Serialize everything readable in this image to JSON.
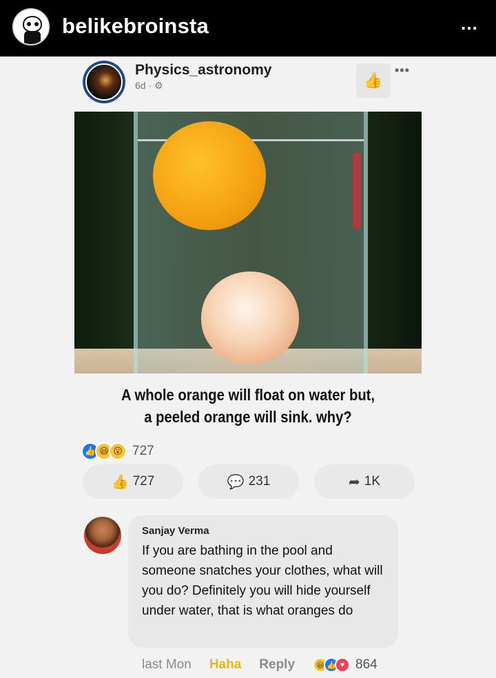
{
  "instagram": {
    "username": "belikebroinsta",
    "more_label": "…"
  },
  "post": {
    "page_name": "Physics_astronomy",
    "meta": "6d · ⚙",
    "like_page_icon": "thumbs-up-icon",
    "more_label": "•••",
    "caption_line1": "A whole orange will float on water but,",
    "caption_line2": "a peeled orange will sink. why?",
    "reaction_count": "727",
    "actions": {
      "like": "727",
      "comment": "231",
      "share": "1K"
    }
  },
  "comment": {
    "author": "Sanjay Verma",
    "text": "If you are bathing in the pool and someone snatches your clothes, what will you do? Definitely you will hide yourself under water, that is what oranges do",
    "time": "last Mon",
    "haha_label": "Haha",
    "reply_label": "Reply",
    "reaction_count": "864"
  },
  "colors": {
    "facebook_blue": "#1877f2",
    "haha_yellow": "#e8b61c",
    "instagram_bar": "#000000"
  }
}
